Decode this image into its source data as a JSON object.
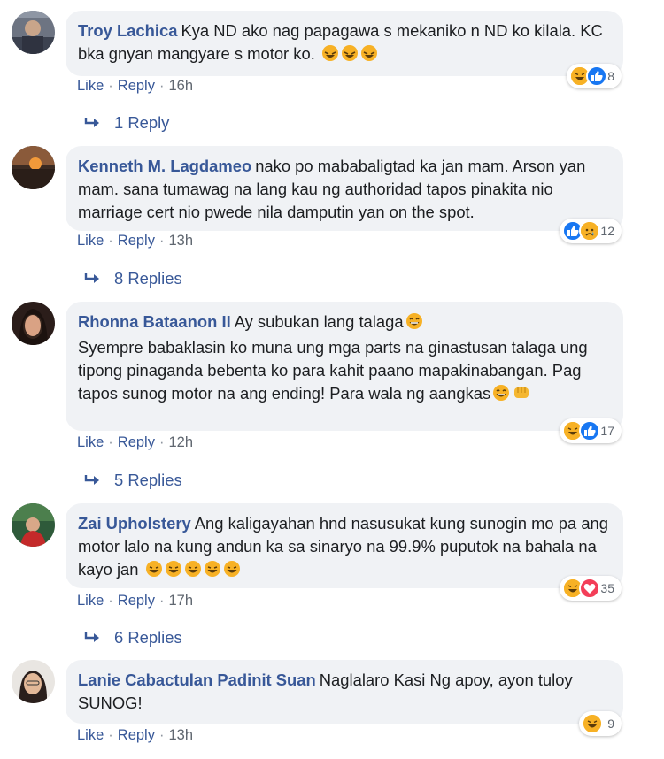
{
  "comments": [
    {
      "author": "Troy Lachica",
      "text": "Kya ND ako nag papagawa s mekaniko n ND ko kilala. KC bka gnyan mangyare s motor ko.",
      "emojis": [
        "rofl-emoji",
        "rofl-emoji",
        "rofl-emoji"
      ],
      "reaction_count": "8",
      "reactions": [
        "haha",
        "like"
      ],
      "like_label": "Like",
      "reply_label": "Reply",
      "time": "16h",
      "replies_label": "1 Reply"
    },
    {
      "author": "Kenneth M. Lagdameo",
      "text": "nako po mababaligtad ka jan mam. Arson yan mam. sana tumawag na lang kau ng authoridad tapos pinakita nio marriage cert nio pwede nila damputin yan on the spot.",
      "emojis": [],
      "reaction_count": "12",
      "reactions": [
        "like",
        "sad"
      ],
      "like_label": "Like",
      "reply_label": "Reply",
      "time": "13h",
      "replies_label": "8 Replies"
    },
    {
      "author": "Rhonna Bataanon II",
      "text_line1": "Ay subukan lang talaga",
      "text_rest": "Syempre babaklasin ko muna ung mga parts na ginastusan talaga ung tipong pinaganda bebenta ko para kahit paano mapakinabangan. Pag tapos sunog motor na ang ending! Para wala ng aangkas",
      "reaction_count": "17",
      "reactions": [
        "haha",
        "like"
      ],
      "like_label": "Like",
      "reply_label": "Reply",
      "time": "12h",
      "replies_label": "5 Replies"
    },
    {
      "author": "Zai Upholstery",
      "text": "Ang kaligayahan hnd nasusukat kung sunogin mo pa ang motor lalo na kung andun ka sa sinaryo na 99.9% puputok na bahala na kayo jan",
      "emojis": [
        "laughing-emoji",
        "laughing-emoji",
        "laughing-emoji",
        "laughing-emoji",
        "laughing-emoji"
      ],
      "reaction_count": "35",
      "reactions": [
        "haha",
        "love"
      ],
      "like_label": "Like",
      "reply_label": "Reply",
      "time": "17h",
      "replies_label": "6 Replies"
    },
    {
      "author": "Lanie Cabactulan Padinit Suan",
      "text": "Naglalaro Kasi Ng apoy, ayon tuloy SUNOG!",
      "reaction_count": "9",
      "reactions": [
        "haha"
      ],
      "like_label": "Like",
      "reply_label": "Reply",
      "time": "13h"
    }
  ],
  "colors": {
    "link": "#385898",
    "bubble": "#f0f2f5",
    "haha": "#f7b125",
    "like": "#1877f2",
    "love": "#f33e58"
  }
}
